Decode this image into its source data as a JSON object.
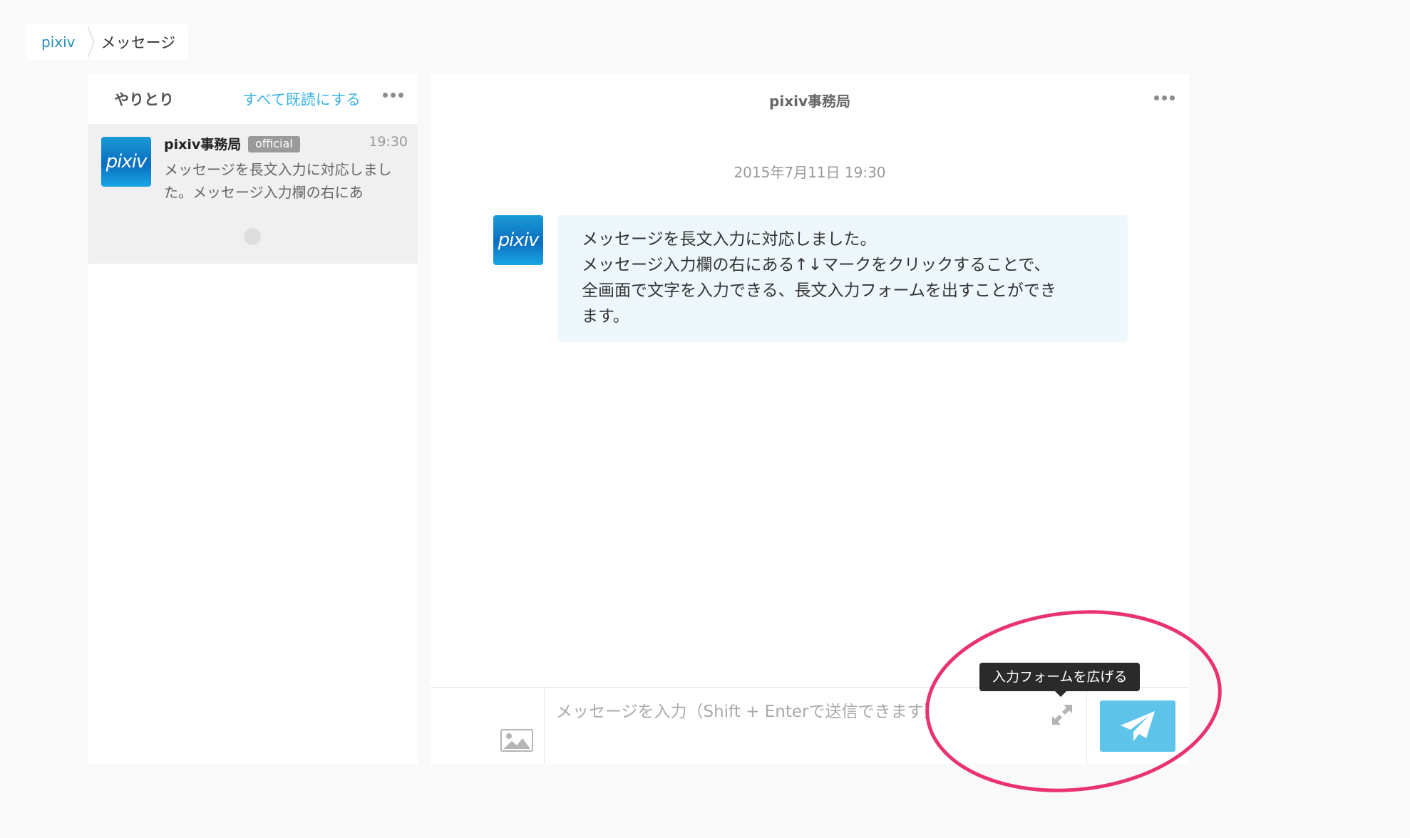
{
  "breadcrumb": {
    "root": "pixiv",
    "current": "メッセージ"
  },
  "sidebar": {
    "title": "やりとり",
    "mark_all_read": "すべて既読にする",
    "threads": [
      {
        "name": "pixiv事務局",
        "badge": "official",
        "time": "19:30",
        "preview": "メッセージを長文入力に対応しました。メッセージ入力欄の右にあ",
        "avatar_text": "pixiv"
      }
    ]
  },
  "chat": {
    "title": "pixiv事務局",
    "date": "2015年7月11日 19:30",
    "avatar_text": "pixiv",
    "message_lines": [
      "メッセージを長文入力に対応しました。",
      "メッセージ入力欄の右にある↑↓マークをクリックすることで、",
      "全画面で文字を入力できる、長文入力フォームを出すことができ",
      "ます。"
    ]
  },
  "composer": {
    "placeholder": "メッセージを入力（Shift + Enterで送信できます）",
    "expand_tooltip": "入力フォームを広げる"
  },
  "icons": {
    "more": "more-dots-icon",
    "image": "image-icon",
    "expand": "expand-icon",
    "send": "paper-plane-icon"
  },
  "colors": {
    "link": "#3cb4e6",
    "breadcrumb_link": "#258fb8",
    "send_button": "#5fc4ea",
    "bubble": "#eef7fc",
    "badge": "#9a9a9a",
    "annotation": "#e8336e",
    "tooltip": "#2a2a2a"
  }
}
